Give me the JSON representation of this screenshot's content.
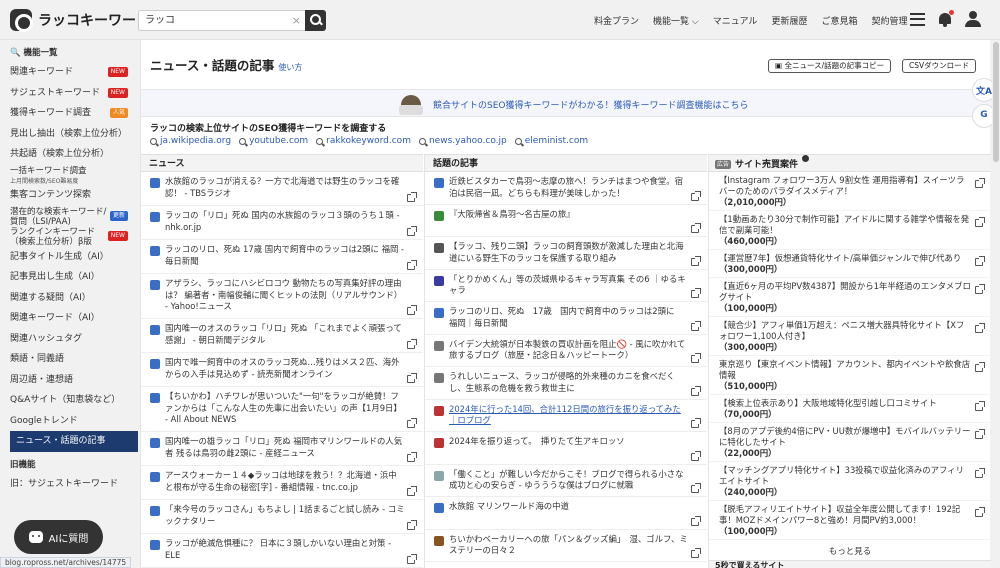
{
  "app": {
    "logo_text": "ラッコキーワード"
  },
  "search": {
    "value": "ラッコ",
    "clear": "×"
  },
  "nav": [
    {
      "label": "料金プラン"
    },
    {
      "label": "機能一覧 ⌵"
    },
    {
      "label": "マニュアル"
    },
    {
      "label": "更新履歴"
    },
    {
      "label": "ご意見箱"
    },
    {
      "label": "契約管理"
    }
  ],
  "sidebar": {
    "heading": "機能一覧",
    "items": [
      {
        "label": "関連キーワード",
        "badge": "NEW",
        "badge_color": "#dd2222"
      },
      {
        "label": "サジェストキーワード",
        "badge": "NEW",
        "badge_color": "#dd2222"
      },
      {
        "label": "獲得キーワード調査",
        "badge": "人気",
        "badge_color": "#f08a24"
      },
      {
        "label": "見出し抽出（検索上位分析）"
      },
      {
        "label": "共起語（検索上位分析）"
      },
      {
        "label": "一括キーワード調査",
        "sub": "上月間検索数/SEO難易度"
      },
      {
        "label": "集客コンテンツ探索"
      },
      {
        "label": "潜在的な検索キーワード/",
        "label2": "質問（LSI/PAA)",
        "badge": "更新",
        "badge_color": "#2b63c6"
      },
      {
        "label": "ランクインキーワード",
        "label2": "（検索上位分析）β版",
        "badge": "NEW",
        "badge_color": "#dd2222"
      },
      {
        "label": "記事タイトル生成（AI）"
      },
      {
        "label": "記事見出し生成（AI）"
      },
      {
        "label": "関連する疑問（AI）"
      },
      {
        "label": "関連キーワード（AI）"
      },
      {
        "label": "関連ハッシュタグ"
      },
      {
        "label": "類語・同義語"
      },
      {
        "label": "周辺語・連想語"
      },
      {
        "label": "Q&Aサイト（知恵袋など）"
      },
      {
        "label": "Googleトレンド"
      },
      {
        "label": "ニュース・話題の記事",
        "active": true
      },
      {
        "label": "旧機能",
        "heading": true
      },
      {
        "label": "旧：サジェストキーワード"
      }
    ]
  },
  "page": {
    "title": "ニュース・話題の記事",
    "howto": "使い方",
    "copy_button": "全ニュース/話題の記事コピー",
    "csv_button": "CSVダウンロード"
  },
  "banner": {
    "text": "競合サイトのSEO獲得キーワードがわかる！獲得キーワード調査機能はこちら"
  },
  "seo": {
    "title": "ラッコの検索上位サイトのSEO獲得キーワードを調査する",
    "links": [
      "ja.wikipedia.org",
      "youtube.com",
      "rakkokeyword.com",
      "news.yahoo.co.jp",
      "eleminist.com"
    ]
  },
  "news": {
    "heading": "ニュース",
    "items": [
      {
        "text": "水族館のラッコが消える？一方で北海道では野生のラッコを確認！ - TBSラジオ",
        "color": "#3a6ec4"
      },
      {
        "text": "ラッコの「リロ」死ぬ 国内の水族館のラッコ３頭のうち１頭 - nhk.or.jp",
        "color": "#3a6ec4"
      },
      {
        "text": "ラッコのリロ、死ぬ 17歳 国内で飼育中のラッコは2頭に 福岡 - 毎日新聞",
        "color": "#3a6ec4"
      },
      {
        "text": "アザラシ、ラッコにハシビロコウ 動物たちの写真集好評の理由は？ 編著者・南幅俊輔に聞くヒットの法則（リアルサウンド） - Yahoo!ニュース",
        "color": "#3a6ec4",
        "tall": true
      },
      {
        "text": "国内唯一のオスのラッコ「リロ」死ぬ 「これまでよく頑張って感謝」 - 朝日新聞デジタル",
        "color": "#3a6ec4"
      },
      {
        "text": "国内で唯一飼育中のオスのラッコ死ぬ…残りはメス２匹、海外からの入手は見込めず - 読売新聞オンライン",
        "color": "#3a6ec4"
      },
      {
        "text": "【ちいかわ】ハチワレが思いついた\"一句\"をラッコが絶賛！ファンからは「こんな人生の先輩に出会いたい」の声【1月9日】 - All About NEWS",
        "color": "#3a6ec4",
        "tall": true
      },
      {
        "text": "国内唯一の雄ラッコ「リロ」死ぬ 福岡市マリンワールドの人気者 残るは鳥羽の雌2頭に - 産経ニュース",
        "color": "#3a6ec4"
      },
      {
        "text": "アースウォーカー１４◆ラッコは地球を救う！？北海道・浜中と根布が守る生命の秘密[字] - 番組情報 - tnc.co.jp",
        "color": "#3a6ec4"
      },
      {
        "text": "「来今号のラッコさん」もちよし | 1話まるごと試し読み - コミックナタリー",
        "color": "#3a6ec4"
      },
      {
        "text": "ラッコが絶滅危惧種に？ 日本に３頭しかいない理由と対策 - ELE",
        "color": "#3a6ec4"
      }
    ]
  },
  "topics": {
    "heading": "話題の記事",
    "items": [
      {
        "text": "近鉄ビスタカーで鳥羽〜志摩の旅へ！ランチはまつや食堂。宿泊は民宿一凪。どちらも料理が美味しかった！",
        "color": "#3a6ec4"
      },
      {
        "text": "『大阪帰省＆鳥羽〜名古屋の旅』",
        "color": "#3a8a3a"
      },
      {
        "text": "【ラッコ、残り二頭】ラッコの飼育頭数が激減した理由と北海道にいる野生下のラッコを保護する取り組み",
        "color": "#555555"
      },
      {
        "text": "「とりかめくん」等の茨城県ゆるキャラ写真集 その6 ｜ゆるキャラ",
        "color": "#3a3aa0"
      },
      {
        "text": "ラッコのリロ、死ぬ　17歳　国内で飼育中のラッコは2頭に　福岡｜毎日新聞",
        "color": "#3a6ec4"
      },
      {
        "text": "バイデン大統領が日本製鉄の買収計画を阻止🚫 - 風に吹かれて旅するブログ（旅歴・記念日＆ハッピートーク）",
        "color": "#777777"
      },
      {
        "text": "うれしいニュース、ラッコが侵略的外来種のカニを食べだくし、生態系の危機を救う救世主に",
        "color": "#777777"
      },
      {
        "text": "2024年に行った14回、合計112日間の旅行を振り返ってみた｜ロブログ",
        "color": "#bb3333",
        "hl": true
      },
      {
        "text": "2024年を振り返って。　挿りたて生アキロッソ",
        "color": "#bb3333"
      },
      {
        "text": "「働くこと」が難しい今だからこそ！ブログで得られる小さな成功と心の安らぎ - ゆうううな僕はブログに就職",
        "color": "#8aa8a8"
      },
      {
        "text": "水族館 マリンワールド海の中道",
        "color": "#3a6ec4"
      },
      {
        "text": "ちいかわベーカリーへの旅「パン＆グッズ編」　湿、ゴルフ、ミステリーの日々２",
        "color": "#885522"
      }
    ]
  },
  "sales": {
    "ad_tag": "広告",
    "heading": "サイト売買案件",
    "items": [
      {
        "text": "【Instagram フォロワー3万人 9割女性 運用指導有】スイーツラバーのためのパラダイスメディア！",
        "price": "（2,010,000円）"
      },
      {
        "text": "【1動画あたり30分で制作可能】アイドルに関する雑学や情報を発信で副業可能！",
        "price": "（460,000円）"
      },
      {
        "text": "【運営歴7年】仮想通貨特化サイト/高単価ジャンルで伸び代あり",
        "price": "（300,000円）"
      },
      {
        "text": "【直近6ヶ月の平均PV数4387】開設から1年半経過のエンタメブログサイト",
        "price": "（100,000円）"
      },
      {
        "text": "【競合少】アフィ単価1万超え：ペニス増大器具特化サイト【Xフォロワー1,100人付き】",
        "price": "（300,000円）"
      },
      {
        "text": "東京巡り【東京イベント情報】アカウント、都内イベントや飲食店情報",
        "price": "（510,000円）"
      },
      {
        "text": "【検索上位表示あり】大阪地域特化型引越し口コミサイト",
        "price": "（70,000円）"
      },
      {
        "text": "【8月のアプデ後約4倍にPV・UU数が爆増中】モバイルバッテリーに特化したサイト",
        "price": "（22,000円）"
      },
      {
        "text": "【マッチングアプリ特化サイト】33投稿で収益化済みのアフィリエイトサイト",
        "price": "（240,000円）"
      },
      {
        "text": "【脱毛アフィリエイトサイト】収益全年度公開してます！192記事！MOZドメインパワー8と強め！月間PV約3,000！",
        "price": "（100,000円）"
      }
    ],
    "more": "もっと見る",
    "next_heading": "5秒で買えるサイト"
  },
  "fab": {
    "label": "AIに質問"
  },
  "statusbar": {
    "url": "blog.ropross.net/archives/14775"
  },
  "side_buttons": [
    {
      "label": "文A"
    },
    {
      "label": "G"
    }
  ]
}
